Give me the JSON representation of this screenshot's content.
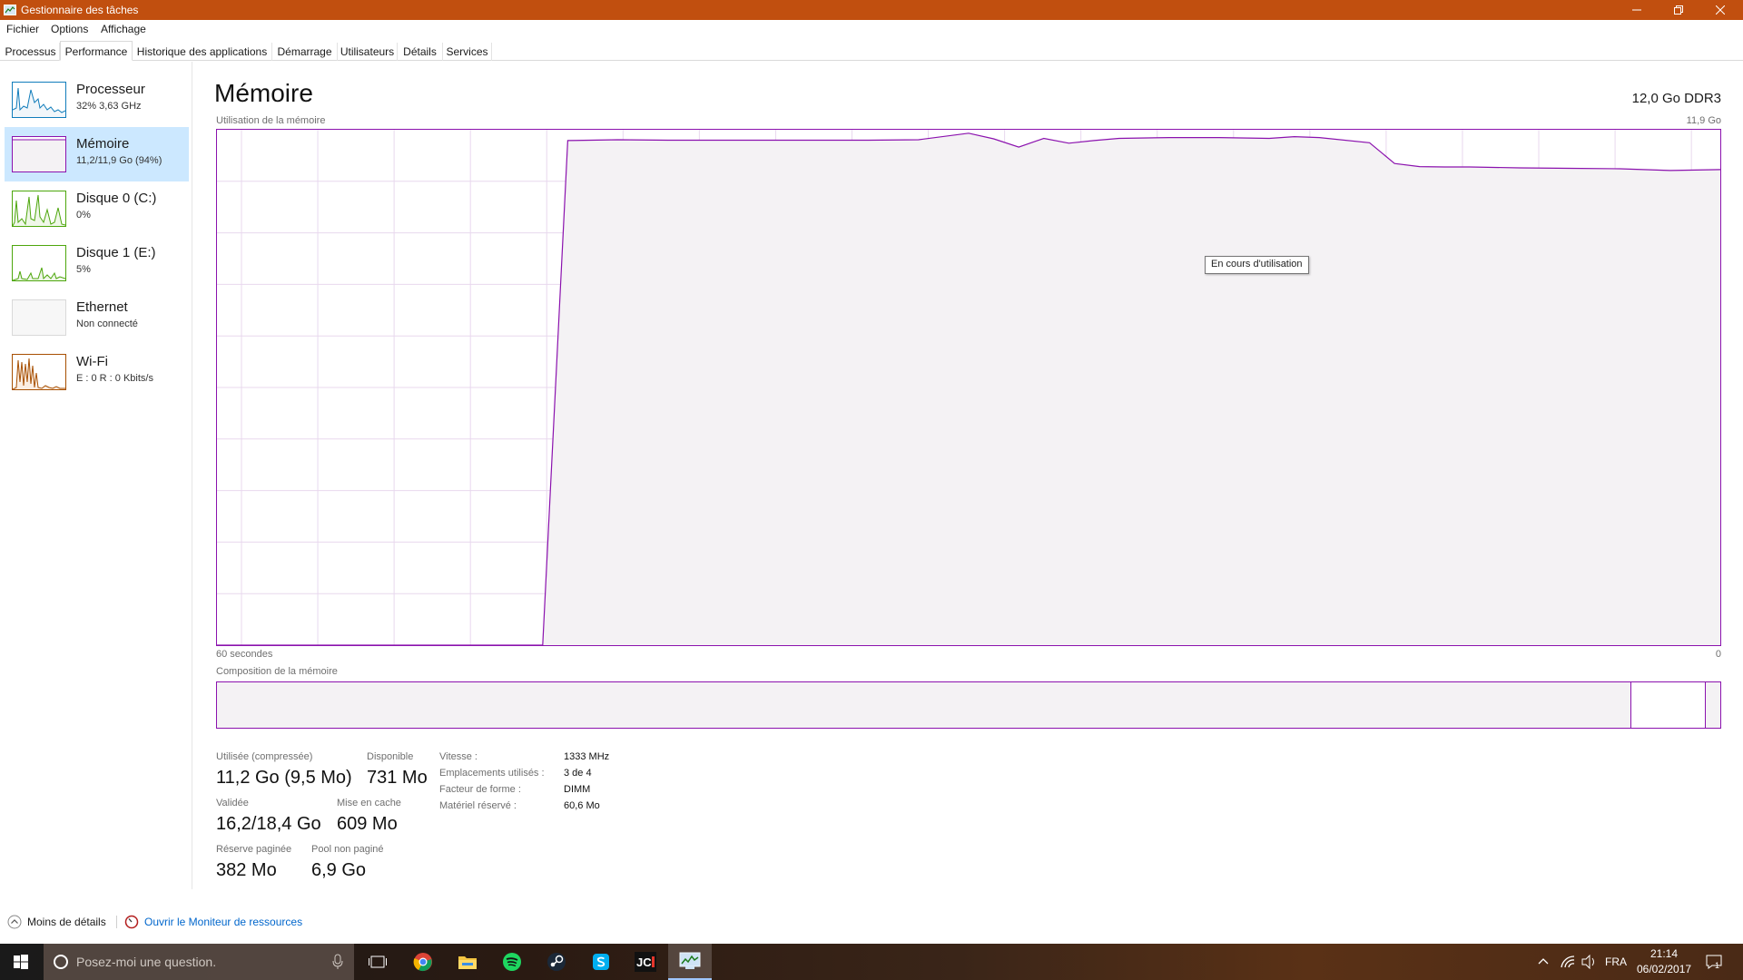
{
  "window": {
    "title": "Gestionnaire des tâches",
    "controls": [
      "minimize-icon",
      "restore-icon",
      "close-icon"
    ]
  },
  "menu": {
    "items": [
      "Fichier",
      "Options",
      "Affichage"
    ]
  },
  "tabs": [
    {
      "label": "Processus"
    },
    {
      "label": "Performance",
      "active": true
    },
    {
      "label": "Historique des applications"
    },
    {
      "label": "Démarrage"
    },
    {
      "label": "Utilisateurs"
    },
    {
      "label": "Détails"
    },
    {
      "label": "Services"
    }
  ],
  "sidebar": {
    "items": [
      {
        "name": "Processeur",
        "sub": "32% 3,63 GHz",
        "color": "#117dbb",
        "selected": false
      },
      {
        "name": "Mémoire",
        "sub": "11,2/11,9 Go (94%)",
        "color": "#8b12ae",
        "selected": true
      },
      {
        "name": "Disque 0 (C:)",
        "sub": "0%",
        "color": "#4da60c",
        "selected": false
      },
      {
        "name": "Disque 1 (E:)",
        "sub": "5%",
        "color": "#4da60c",
        "selected": false
      },
      {
        "name": "Ethernet",
        "sub": "Non connecté",
        "color": "#a74f01",
        "selected": false
      },
      {
        "name": "Wi-Fi",
        "sub": "E : 0 R : 0 Kbits/s",
        "color": "#a74f01",
        "selected": false
      }
    ]
  },
  "main": {
    "title": "Mémoire",
    "spec": "12,0 Go DDR3",
    "graph_label": "Utilisation de la mémoire",
    "graph_max": "11,9 Go",
    "time_left": "60 secondes",
    "time_right": "0",
    "tooltip": "En cours d'utilisation",
    "composition_label": "Composition de la mémoire",
    "composition": {
      "in_use_fraction": 0.94,
      "modified_fraction": 0.005,
      "standby_fraction": 0.05,
      "free_fraction": 0.005
    }
  },
  "chart_data": {
    "type": "area",
    "title": "",
    "xlabel": "",
    "ylabel": "Utilisation de la mémoire",
    "x_range_seconds": [
      60,
      0
    ],
    "ylim": [
      0,
      11.9
    ],
    "unit": "Go",
    "grid": true,
    "series": [
      {
        "name": "",
        "x": [
          60,
          47,
          46,
          44,
          42,
          40,
          38,
          36,
          34,
          32,
          30,
          29,
          28,
          27,
          26,
          25,
          24,
          22,
          20,
          18,
          17,
          16,
          14,
          13,
          12,
          11,
          10,
          8,
          6,
          4,
          2,
          0
        ],
        "y": [
          0,
          0,
          11.65,
          11.67,
          11.66,
          11.66,
          11.66,
          11.66,
          11.66,
          11.67,
          11.82,
          11.69,
          11.5,
          11.7,
          11.59,
          11.65,
          11.7,
          11.72,
          11.72,
          11.7,
          11.74,
          11.72,
          11.6,
          11.12,
          11.05,
          11.04,
          11.04,
          11.02,
          11.01,
          11.0,
          10.96,
          10.98
        ]
      }
    ]
  },
  "stats": {
    "used": {
      "label": "Utilisée (compressée)",
      "value": "11,2 Go (9,5 Mo)"
    },
    "available": {
      "label": "Disponible",
      "value": "731 Mo"
    },
    "committed": {
      "label": "Validée",
      "value": "16,2/18,4 Go"
    },
    "cached": {
      "label": "Mise en cache",
      "value": "609 Mo"
    },
    "paged_pool": {
      "label": "Réserve paginée",
      "value": "382 Mo"
    },
    "nonpaged_pool": {
      "label": "Pool non paginé",
      "value": "6,9 Go"
    }
  },
  "specs": [
    {
      "label": "Vitesse :",
      "value": "1333 MHz"
    },
    {
      "label": "Emplacements utilisés :",
      "value": "3 de 4"
    },
    {
      "label": "Facteur de forme :",
      "value": "DIMM"
    },
    {
      "label": "Matériel réservé :",
      "value": "60,6 Mo"
    }
  ],
  "footer": {
    "fewer_details": "Moins de détails",
    "resource_monitor": "Ouvrir le Moniteur de ressources"
  },
  "taskbar": {
    "search_placeholder": "Posez-moi une question.",
    "apps": [
      "chrome-icon",
      "file-explorer-icon",
      "spotify-icon",
      "steam-icon",
      "skype-icon",
      "jc-app-icon",
      "task-manager-icon"
    ],
    "tray": {
      "language": "FRA",
      "time": "21:14",
      "date": "06/02/2017",
      "notifications": "1"
    }
  },
  "colors": {
    "titlebar": "#c14f0f",
    "memory_accent": "#8b12ae",
    "memory_fill": "#f4f2f4",
    "link": "#0066cc"
  }
}
